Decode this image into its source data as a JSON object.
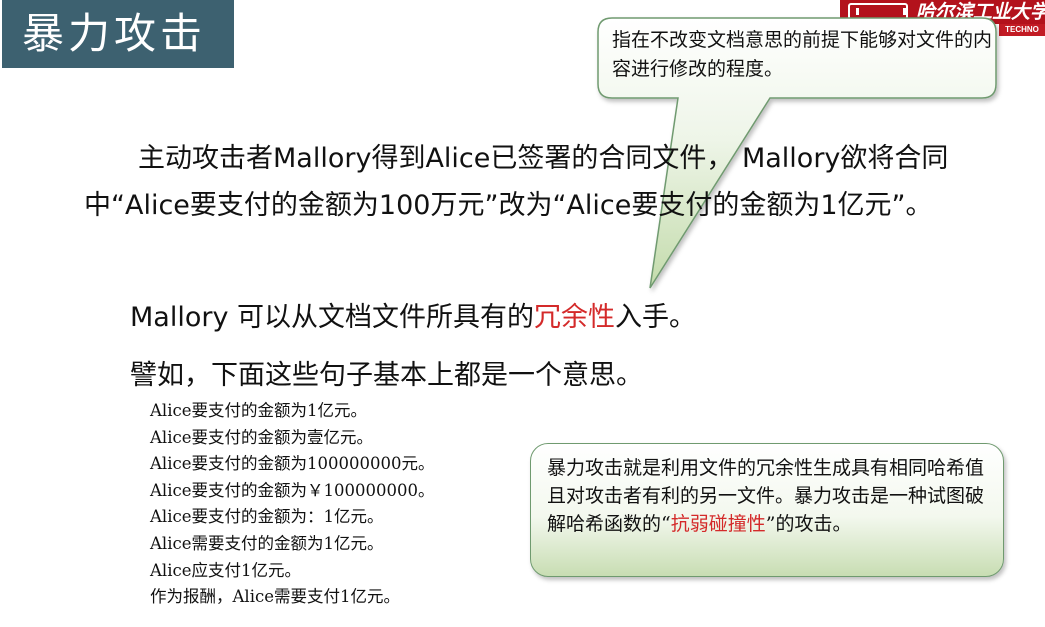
{
  "slide": {
    "title": "暴力攻击"
  },
  "logo": {
    "name": "哈尔滨工业大学",
    "en": "TECHNO"
  },
  "callout": {
    "text": "指在不改变文档意思的前提下能够对文件的内容进行修改的程度。"
  },
  "paragraph": {
    "text": "主动攻击者Mallory得到Alice已签署的合同文件， Mallory欲将合同中“Alice要支付的金额为100万元”改为“Alice要支付的金额为1亿元”。"
  },
  "redundancy": {
    "before": "Mallory 可以从文档文件所具有的",
    "highlight": "冗余性",
    "after": "入手。"
  },
  "intro": {
    "text": "譬如，下面这些句子基本上都是一个意思。"
  },
  "examples": [
    "Alice要支付的金额为1亿元。",
    "Alice要支付的金额为壹亿元。",
    "Alice要支付的金额为100000000元。",
    "Alice要支付的金额为￥100000000。",
    "Alice要支付的金额为：1亿元。",
    "Alice需要支付的金额为1亿元。",
    "Alice应支付1亿元。",
    "作为报酬，Alice需要支付1亿元。"
  ],
  "note": {
    "text_before": "暴力攻击就是利用文件的冗余性生成具有相同哈希值且对攻击者有利的另一文件。暴力攻击是一种试图破解哈希函数的“",
    "highlight": "抗弱碰撞性",
    "text_after": "”的攻击。"
  },
  "colors": {
    "title_bg": "#3d6170",
    "highlight": "#d42a2a",
    "callout_border": "#6f9a6f",
    "logo_red": "#b3121c"
  }
}
